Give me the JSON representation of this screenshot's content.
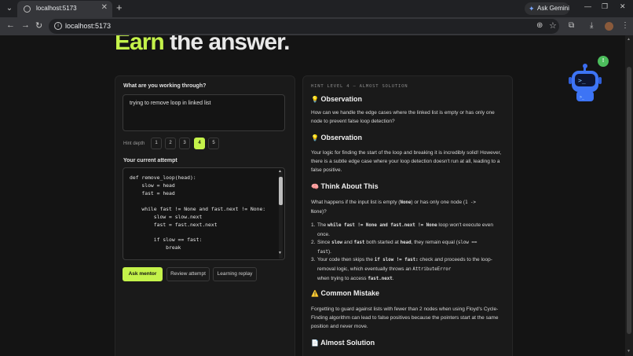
{
  "browser": {
    "tab_title": "localhost:5173",
    "url": "localhost:5173",
    "gemini_label": "Ask Gemini"
  },
  "page": {
    "headline_accent": "Earn",
    "headline_rest": "the answer."
  },
  "left": {
    "working_label": "What are you working through?",
    "prompt_value": "trying to remove  loop in linked list",
    "hint_depth_label": "Hint depth",
    "depths": [
      "1",
      "2",
      "3",
      "4",
      "5"
    ],
    "selected_depth": 4,
    "attempt_label": "Your current attempt",
    "code_lines": [
      "def remove_loop(head):",
      "    slow = head",
      "    fast = head",
      "",
      "    while fast != None and fast.next != None:",
      "        slow = slow.next",
      "        fast = fast.next.next",
      "",
      "        if slow == fast:",
      "            break"
    ],
    "buttons": {
      "ask": "Ask mentor",
      "review": "Review attempt",
      "replay": "Learning replay"
    }
  },
  "right": {
    "hint_level": "HINT LEVEL 4 — ALMOST SOLUTION",
    "obs1_title": "Observation",
    "obs1_text": "How can we handle the edge cases where the linked list is empty or has only one node to prevent false loop detection?",
    "obs2_title": "Observation",
    "obs2_text": "Your logic for finding the start of the loop and breaking it is incredibly solid! However, there is a subtle edge case where your loop detection doesn't run at all, leading to a false positive.",
    "think_title": "Think About This",
    "think_a": "What happens if the input list is empty (",
    "think_none1": "None",
    "think_b": ") or has only one node (",
    "think_code": "1 ->",
    "think_none2": "None",
    "think_c": ")?",
    "li1_a": "The ",
    "li1_code": "while fast != None and fast.next != None",
    "li1_b": " loop won't execute even once.",
    "li2_a": "Since ",
    "li2_slow": "slow",
    "li2_b": " and ",
    "li2_fast": "fast",
    "li2_c": " both started at ",
    "li2_head": "head",
    "li2_d": ", they remain equal (",
    "li2_code1": "slow ==",
    "li2_code2": "fast",
    "li2_e": ").",
    "li3_a": "Your code then skips the ",
    "li3_code": "if slow != fast:",
    "li3_b": " check and proceeds to the loop-removal logic, which eventually throws an ",
    "li3_err": "AttributeError",
    "li3_c": " when trying to access ",
    "li3_fn": "fast.next",
    "li3_d": ".",
    "mistake_title": "Common Mistake",
    "mistake_text": "Forgetting to guard against lists with fewer than 2 nodes when using Floyd's Cycle-Finding algorithm can lead to false positives because the pointers start at the same position and never move.",
    "almost_title": "Almost Solution"
  },
  "mascot": {
    "badge": "!"
  },
  "colors": {
    "accent": "#c4f24a",
    "background": "#141414",
    "card": "#1a1a1a"
  },
  "icons": {
    "observation": "lightbulb-icon",
    "think": "brain-icon",
    "mistake": "warning-icon",
    "almost": "memo-icon"
  }
}
